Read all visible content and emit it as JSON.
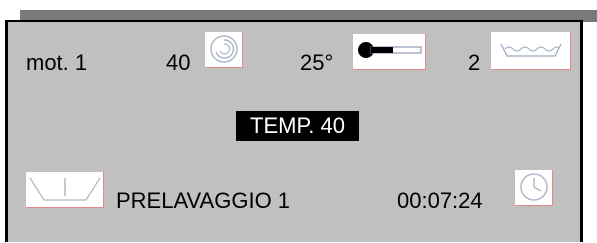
{
  "row1": {
    "motor_label": "mot. 1",
    "speed_value": "40",
    "temperature_value": "25°",
    "level_value": "2"
  },
  "temp_display": "TEMP. 40",
  "row3": {
    "program_name": "PRELAVAGGIO 1",
    "time_value": "00:07:24"
  },
  "icons": {
    "speed": "spin-icon",
    "temperature": "thermometer-icon",
    "level": "water-level-icon",
    "drum": "drum-icon",
    "time": "clock-icon"
  },
  "colors": {
    "screen_bg": "#c0c0c0",
    "frame": "#000000",
    "top_strip": "#7a7a7a",
    "icon_bg": "#ffffff",
    "highlight_bg": "#000000",
    "highlight_text": "#ffffff"
  }
}
